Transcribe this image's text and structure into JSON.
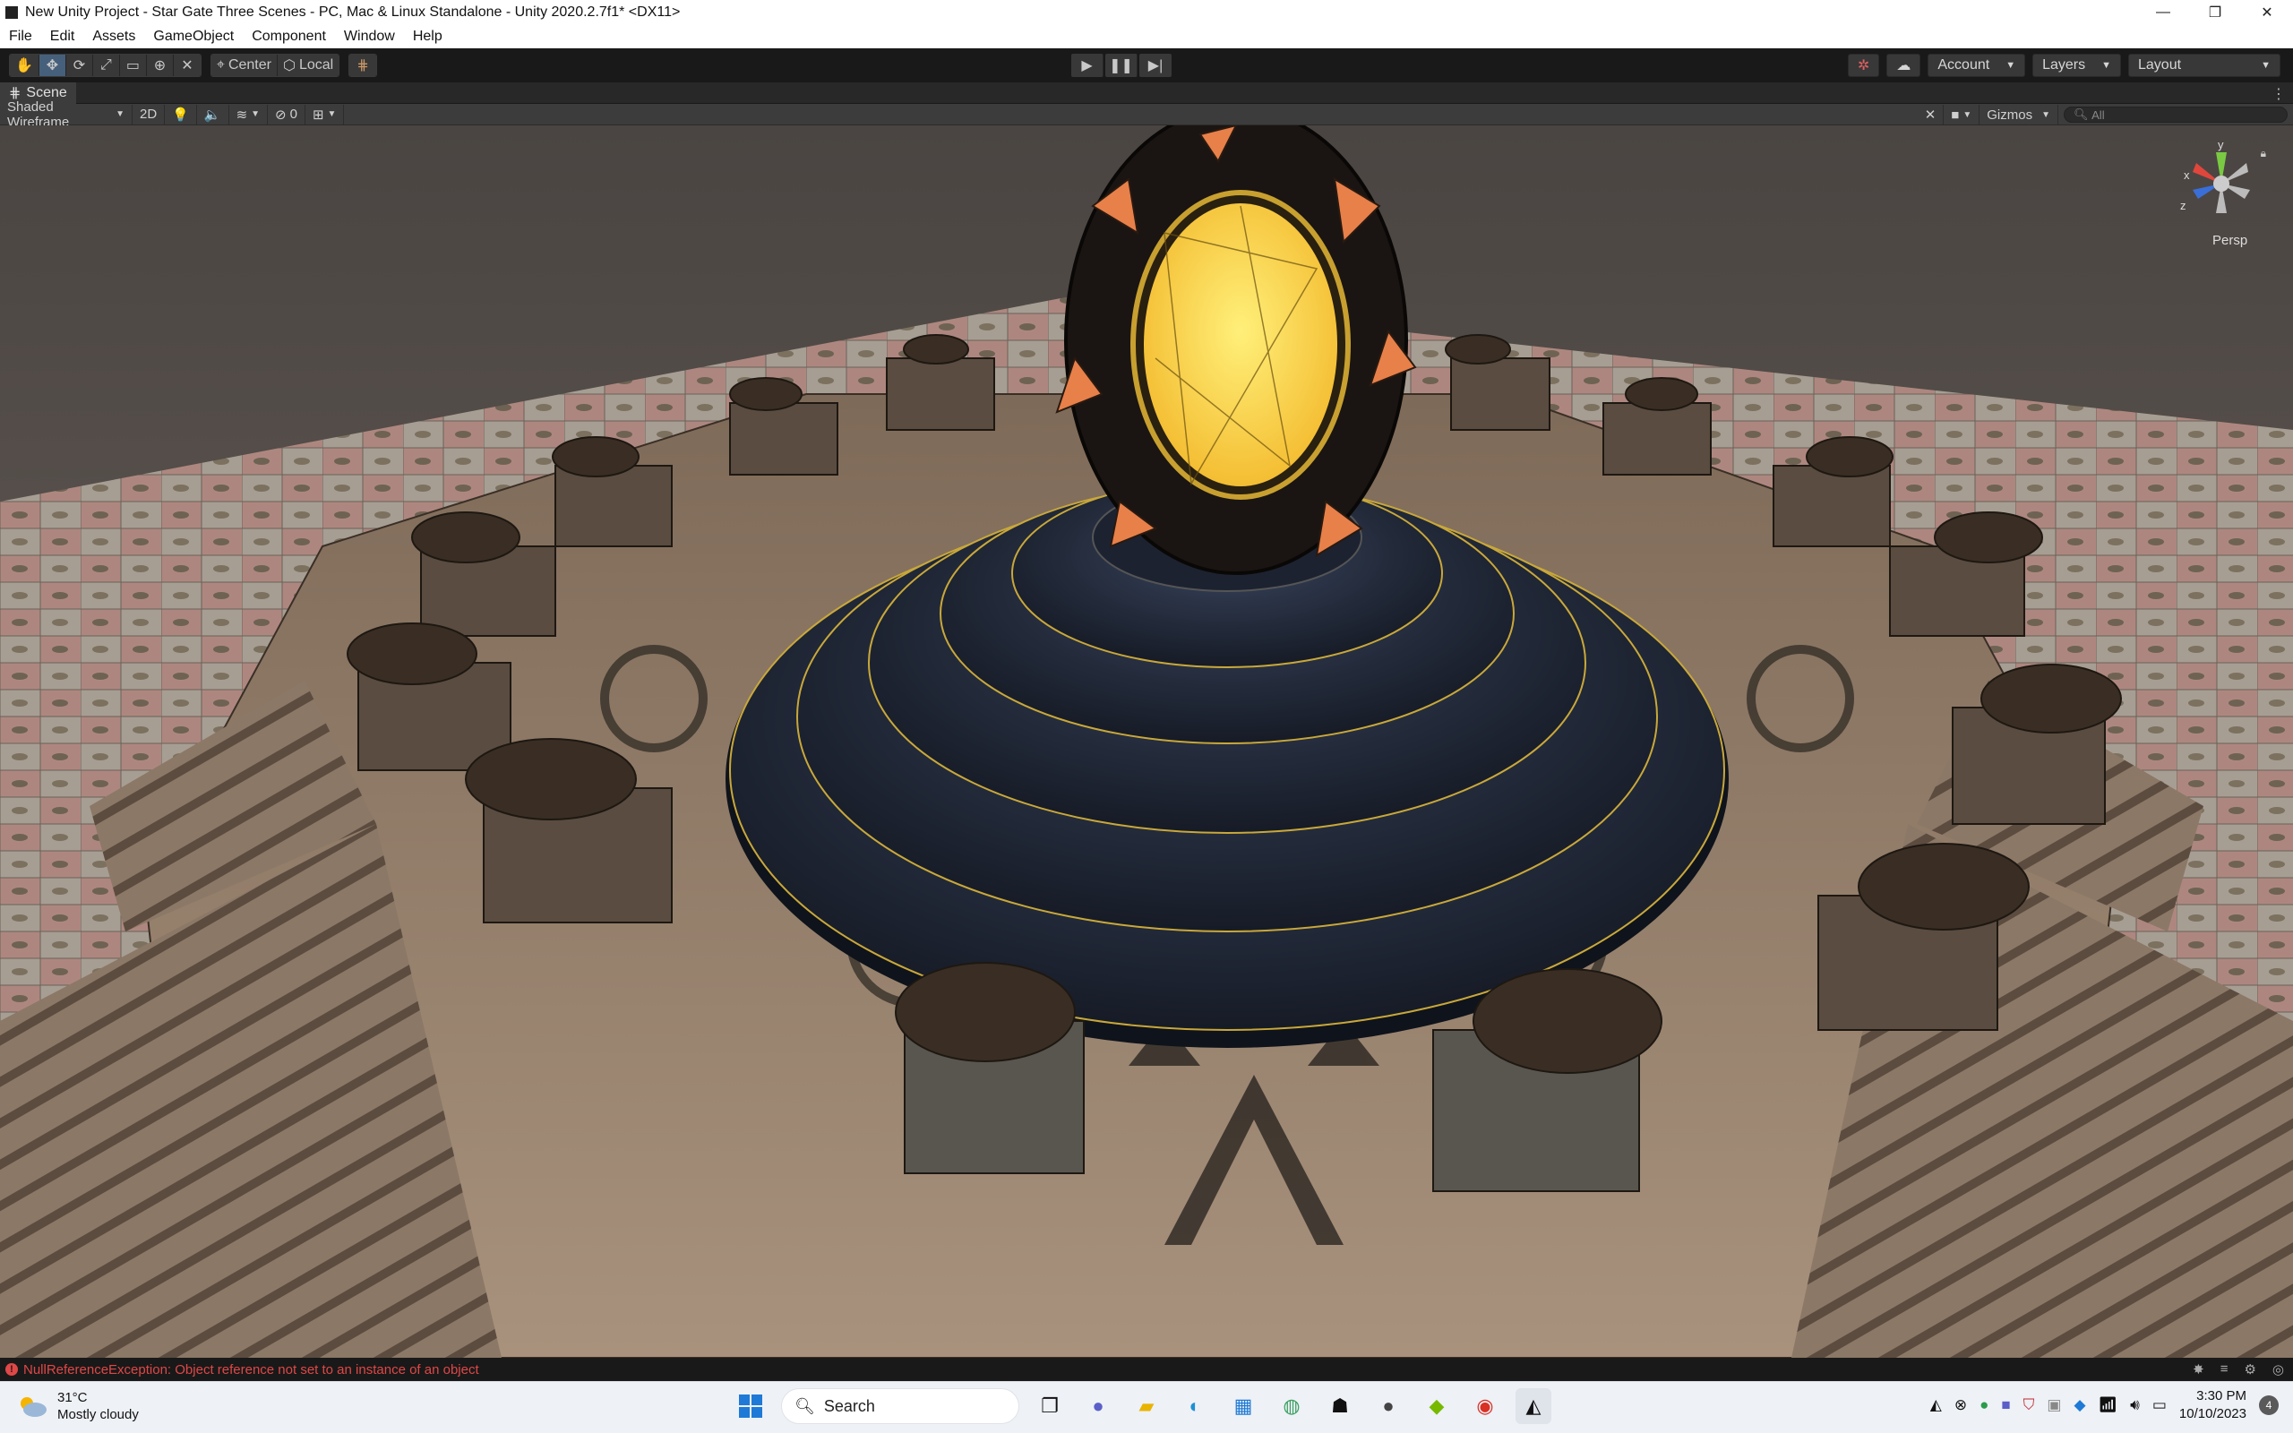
{
  "window": {
    "title": "New Unity Project - Star Gate Three Scenes - PC, Mac & Linux Standalone - Unity 2020.2.7f1* <DX11>",
    "minimize": "—",
    "maximize": "❐",
    "close": "✕"
  },
  "menu": [
    "File",
    "Edit",
    "Assets",
    "GameObject",
    "Component",
    "Window",
    "Help"
  ],
  "toolbar": {
    "tools": [
      "hand-tool",
      "move-tool",
      "rotate-tool",
      "scale-tool",
      "rect-tool",
      "transform-tool",
      "custom-tool"
    ],
    "pivot": "Center",
    "space": "Local",
    "account": "Account",
    "layers": "Layers",
    "layout": "Layout"
  },
  "scene_tab": {
    "label": "Scene"
  },
  "scene_bar": {
    "draw_mode": "Shaded Wireframe",
    "mode_2d": "2D",
    "hidden_count": "0",
    "gizmos": "Gizmos",
    "search_placeholder": "All"
  },
  "gizmo": {
    "y": "y",
    "x": "x",
    "z": "z",
    "projection": "Persp"
  },
  "status": {
    "message": "NullReferenceException: Object reference not set to an instance of an object"
  },
  "taskbar": {
    "temperature": "31°C",
    "weather": "Mostly cloudy",
    "search": "Search",
    "time": "3:30 PM",
    "date": "10/10/2023",
    "notifications": "4"
  },
  "colors": {
    "accent": "#46607c",
    "error": "#e04747",
    "portal": "#ffd84a",
    "ring": "#e8804a"
  }
}
